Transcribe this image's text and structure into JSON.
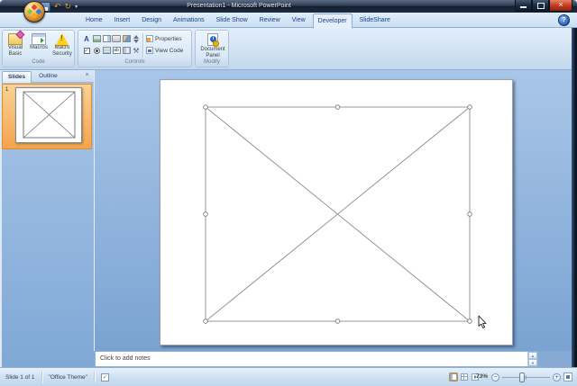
{
  "window": {
    "title": "Presentation1 - Microsoft PowerPoint"
  },
  "ribbon_tabs": {
    "active": "Developer",
    "items": [
      {
        "label": "Home"
      },
      {
        "label": "Insert"
      },
      {
        "label": "Design"
      },
      {
        "label": "Animations"
      },
      {
        "label": "Slide Show"
      },
      {
        "label": "Review"
      },
      {
        "label": "View"
      },
      {
        "label": "Developer"
      },
      {
        "label": "SlideShare"
      }
    ]
  },
  "ribbon": {
    "groups": [
      {
        "label": "Code",
        "buttons": [
          {
            "label": "Visual Basic"
          },
          {
            "label": "Macros"
          },
          {
            "label": "Macro Security"
          }
        ]
      },
      {
        "label": "Controls",
        "buttons": [
          {
            "label": "Properties"
          },
          {
            "label": "View Code"
          }
        ],
        "control_icons": [
          "label",
          "image",
          "combo-box",
          "command-button",
          "picture",
          "spin-button",
          "check-box",
          "option-button",
          "list-box",
          "text-box",
          "scroll-bar",
          "more-controls"
        ]
      },
      {
        "label": "Modify",
        "buttons": [
          {
            "label": "Document Panel"
          }
        ]
      }
    ]
  },
  "slides_panel": {
    "tabs": [
      {
        "label": "Slides"
      },
      {
        "label": "Outline"
      }
    ],
    "slide_number": "1"
  },
  "notes": {
    "placeholder": "Click to add notes"
  },
  "statusbar": {
    "slide_indicator": "Slide 1 of 1",
    "theme_name": "\"Office Theme\"",
    "zoom_level": "73%"
  },
  "icons": {
    "undo": "↶",
    "redo": "↻",
    "qat_menu": "▾",
    "help": "?",
    "close": "×",
    "panel_close": "×",
    "label_control": "A",
    "text_box_control": "ab",
    "more_controls": "⚒",
    "check_mark": "✓",
    "zoom_out": "−",
    "zoom_in": "+",
    "scroll_up": "▲",
    "scroll_down": "▼",
    "macro_warning": "!",
    "document_info": "i"
  },
  "colors": {
    "titlebar": "#1E2B3F",
    "ribbon_bg": "#D3E3F4",
    "tab_text": "#15428B",
    "workspace_top": "#A9C6E8",
    "workspace_bottom": "#7AA3D2",
    "selection_orange": "#F4A44F",
    "close_button_red": "#C43D22"
  }
}
